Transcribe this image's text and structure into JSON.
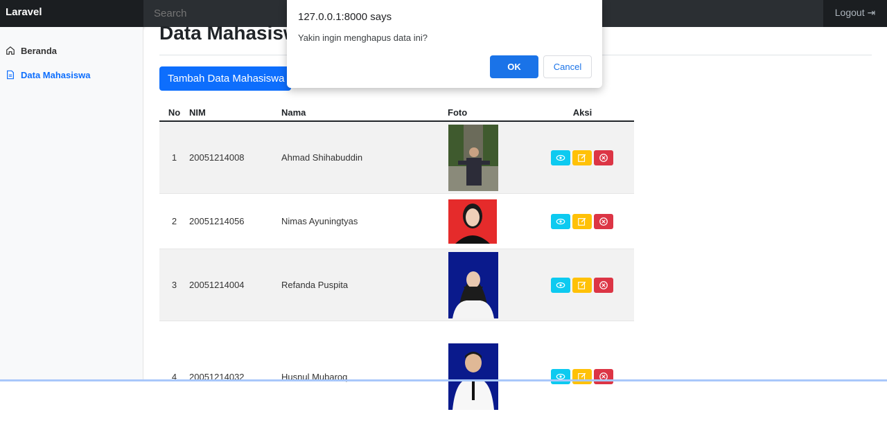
{
  "navbar": {
    "brand": "Laravel",
    "search_placeholder": "Search",
    "logout_label": "Logout",
    "logout_icon": "logout-icon"
  },
  "sidebar": {
    "items": [
      {
        "label": "Beranda",
        "icon": "home-icon"
      },
      {
        "label": "Data Mahasiswa",
        "icon": "document-icon"
      }
    ]
  },
  "main": {
    "title": "Data Mahasiswa",
    "add_button": "Tambah Data Mahasiswa",
    "table": {
      "headers": [
        "No",
        "NIM",
        "Nama",
        "Foto",
        "Aksi"
      ],
      "rows": [
        {
          "no": "1",
          "nim": "20051214008",
          "nama": "Ahmad Shihabuddin"
        },
        {
          "no": "2",
          "nim": "20051214056",
          "nama": "Nimas Ayuningtyas"
        },
        {
          "no": "3",
          "nim": "20051214004",
          "nama": "Refanda Puspita"
        },
        {
          "no": "4",
          "nim": "20051214032",
          "nama": "Husnul Mubaroq"
        }
      ]
    }
  },
  "dialog": {
    "title": "127.0.0.1:8000 says",
    "message": "Yakin ingin menghapus data ini?",
    "ok": "OK",
    "cancel": "Cancel"
  },
  "colors": {
    "primary": "#0d6efd",
    "info": "#0dcaf0",
    "warning": "#ffc107",
    "danger": "#dc3545"
  }
}
